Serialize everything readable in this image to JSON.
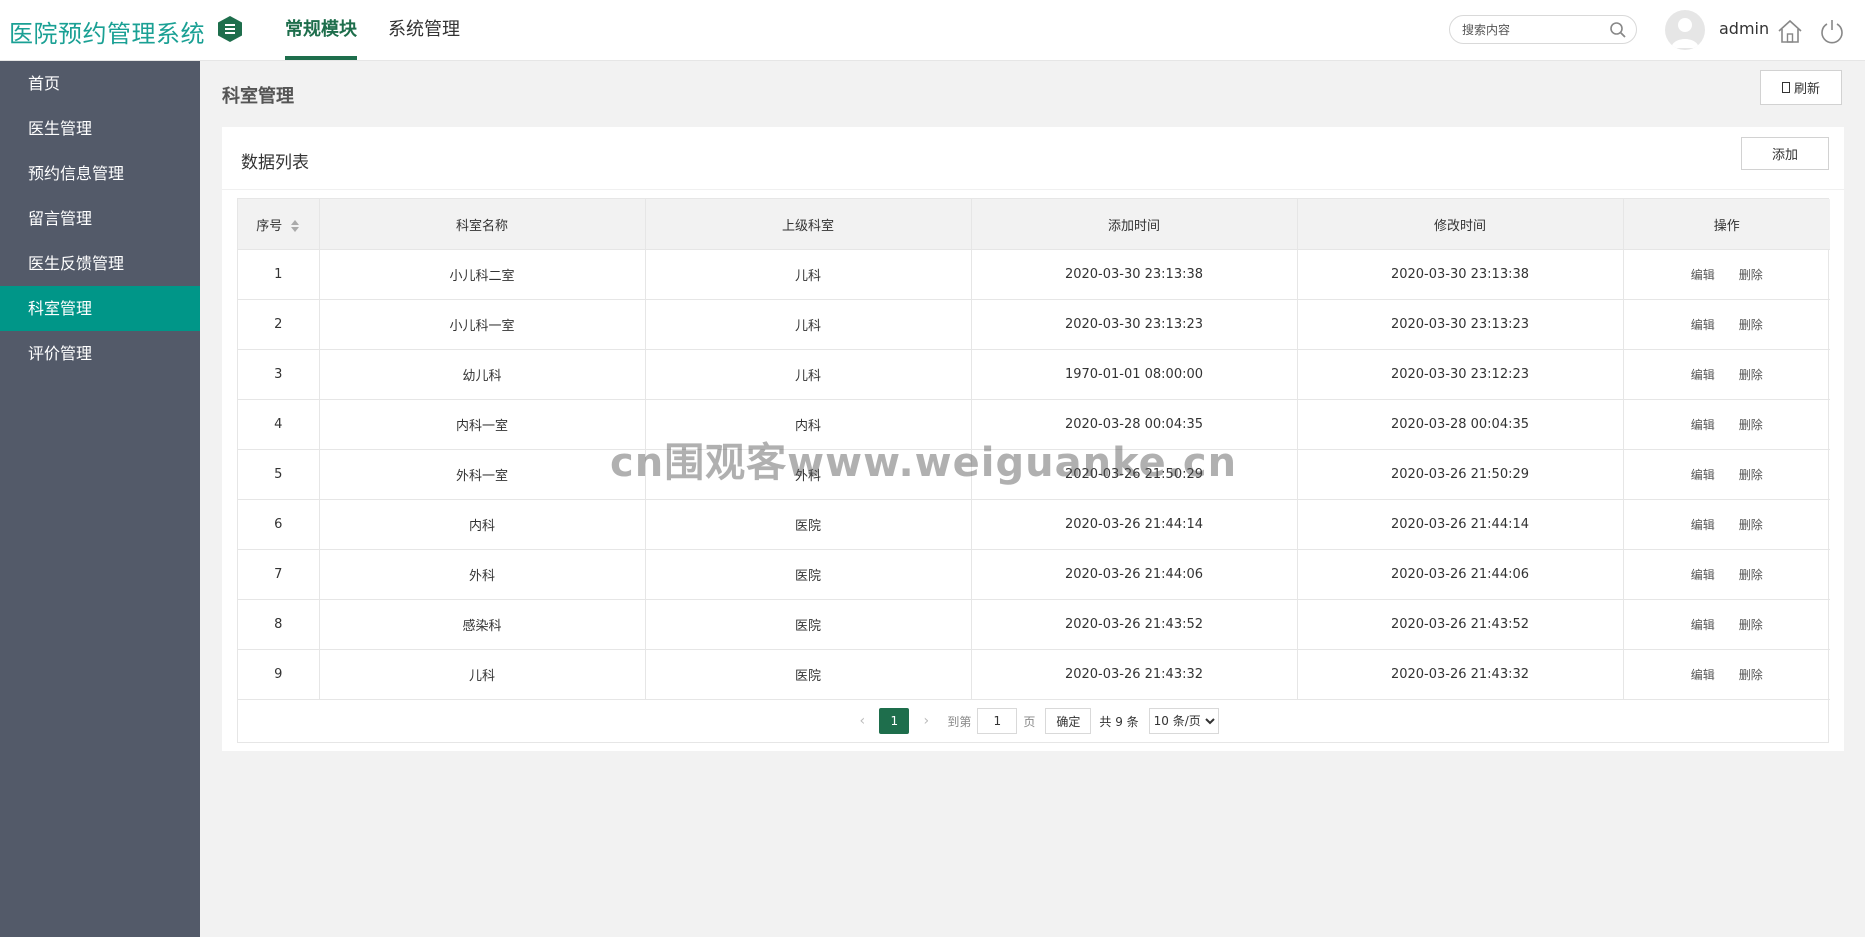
{
  "header": {
    "logo": "医院预约管理系统",
    "tabs": [
      {
        "label": "常规模块",
        "active": true
      },
      {
        "label": "系统管理",
        "active": false
      }
    ],
    "search_placeholder": "搜索内容",
    "username": "admin"
  },
  "sidebar": {
    "items": [
      {
        "label": "首页"
      },
      {
        "label": "医生管理"
      },
      {
        "label": "预约信息管理"
      },
      {
        "label": "留言管理"
      },
      {
        "label": "医生反馈管理"
      },
      {
        "label": "科室管理",
        "active": true
      },
      {
        "label": "评价管理"
      }
    ]
  },
  "page": {
    "title": "科室管理",
    "refresh_label": "刷新"
  },
  "card": {
    "title": "数据列表",
    "add_label": "添加"
  },
  "table": {
    "columns": [
      "序号",
      "科室名称",
      "上级科室",
      "添加时间",
      "修改时间",
      "操作"
    ],
    "edit_label": "编辑",
    "delete_label": "删除",
    "rows": [
      {
        "seq": "1",
        "name": "小儿科二室",
        "parent": "儿科",
        "created": "2020-03-30 23:13:38",
        "modified": "2020-03-30 23:13:38"
      },
      {
        "seq": "2",
        "name": "小儿科一室",
        "parent": "儿科",
        "created": "2020-03-30 23:13:23",
        "modified": "2020-03-30 23:13:23"
      },
      {
        "seq": "3",
        "name": "幼儿科",
        "parent": "儿科",
        "created": "1970-01-01 08:00:00",
        "modified": "2020-03-30 23:12:23"
      },
      {
        "seq": "4",
        "name": "内科一室",
        "parent": "内科",
        "created": "2020-03-28 00:04:35",
        "modified": "2020-03-28 00:04:35"
      },
      {
        "seq": "5",
        "name": "外科一室",
        "parent": "外科",
        "created": "2020-03-26 21:50:29",
        "modified": "2020-03-26 21:50:29"
      },
      {
        "seq": "6",
        "name": "内科",
        "parent": "医院",
        "created": "2020-03-26 21:44:14",
        "modified": "2020-03-26 21:44:14"
      },
      {
        "seq": "7",
        "name": "外科",
        "parent": "医院",
        "created": "2020-03-26 21:44:06",
        "modified": "2020-03-26 21:44:06"
      },
      {
        "seq": "8",
        "name": "感染科",
        "parent": "医院",
        "created": "2020-03-26 21:43:52",
        "modified": "2020-03-26 21:43:52"
      },
      {
        "seq": "9",
        "name": "儿科",
        "parent": "医院",
        "created": "2020-03-26 21:43:32",
        "modified": "2020-03-26 21:43:32"
      }
    ]
  },
  "pagination": {
    "current_page": "1",
    "goto_label": "到第",
    "goto_value": "1",
    "page_unit": "页",
    "confirm_label": "确定",
    "total_label": "共 9 条",
    "page_size": "10 条/页"
  },
  "watermark": "cn围观客www.weiguanke.cn",
  "colors": {
    "logo": "#1aa094",
    "accent": "#1e6e4c",
    "sidebar_bg": "#535a69",
    "sidebar_active": "#009688"
  }
}
